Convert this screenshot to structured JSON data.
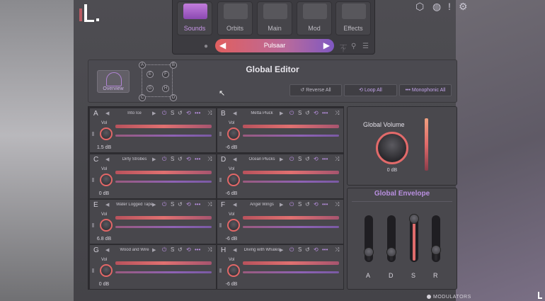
{
  "nav": {
    "tabs": [
      {
        "label": "Sounds",
        "active": true
      },
      {
        "label": "Orbits"
      },
      {
        "label": "Main"
      },
      {
        "label": "Mod"
      },
      {
        "label": "Effects"
      }
    ],
    "preset": {
      "name": "Pulsaar",
      "prev": "◀",
      "next": "▶"
    }
  },
  "top_icons": {
    "exclamation": "!"
  },
  "global_editor": {
    "title": "Global Editor",
    "overview_label": "Overview",
    "grid_nodes": [
      "A",
      "B",
      "C",
      "D",
      "E",
      "F",
      "G",
      "H"
    ],
    "buttons": [
      "Reverse All",
      "Loop All",
      "Monophonic All"
    ]
  },
  "slots": [
    {
      "letter": "A",
      "name": "Into Ice",
      "vol_label": "Vol",
      "db": "1.5 dB"
    },
    {
      "letter": "B",
      "name": "Metta Pluck",
      "vol_label": "Vol",
      "db": "-6 dB"
    },
    {
      "letter": "C",
      "name": "Dirty Strobes",
      "vol_label": "Vol",
      "db": "0 dB"
    },
    {
      "letter": "D",
      "name": "Ocean Plucks",
      "vol_label": "Vol",
      "db": "-6 dB"
    },
    {
      "letter": "E",
      "name": "Water Logged Tape",
      "vol_label": "Vol",
      "db": "6.8 dB"
    },
    {
      "letter": "F",
      "name": "Angel Wings",
      "vol_label": "Vol",
      "db": "-6 dB"
    },
    {
      "letter": "G",
      "name": "Wood and Wire",
      "vol_label": "Vol",
      "db": "0 dB"
    },
    {
      "letter": "H",
      "name": "Diving with Whales",
      "vol_label": "Vol",
      "db": "-6 dB"
    }
  ],
  "slot_controls": {
    "solo": "S"
  },
  "global_volume": {
    "title": "Global Volume",
    "value": "0 dB"
  },
  "global_envelope": {
    "title": "Global Envelope",
    "faders": [
      {
        "name": "A",
        "level": 0.1
      },
      {
        "name": "D",
        "level": 0.1
      },
      {
        "name": "S",
        "level": 1.0
      },
      {
        "name": "R",
        "level": 0.15
      }
    ]
  },
  "footer": {
    "modulators_label": "MODULATORS"
  },
  "colors": {
    "accent": "#e26767",
    "purple": "#b98fe0",
    "panel": "#48474c"
  }
}
